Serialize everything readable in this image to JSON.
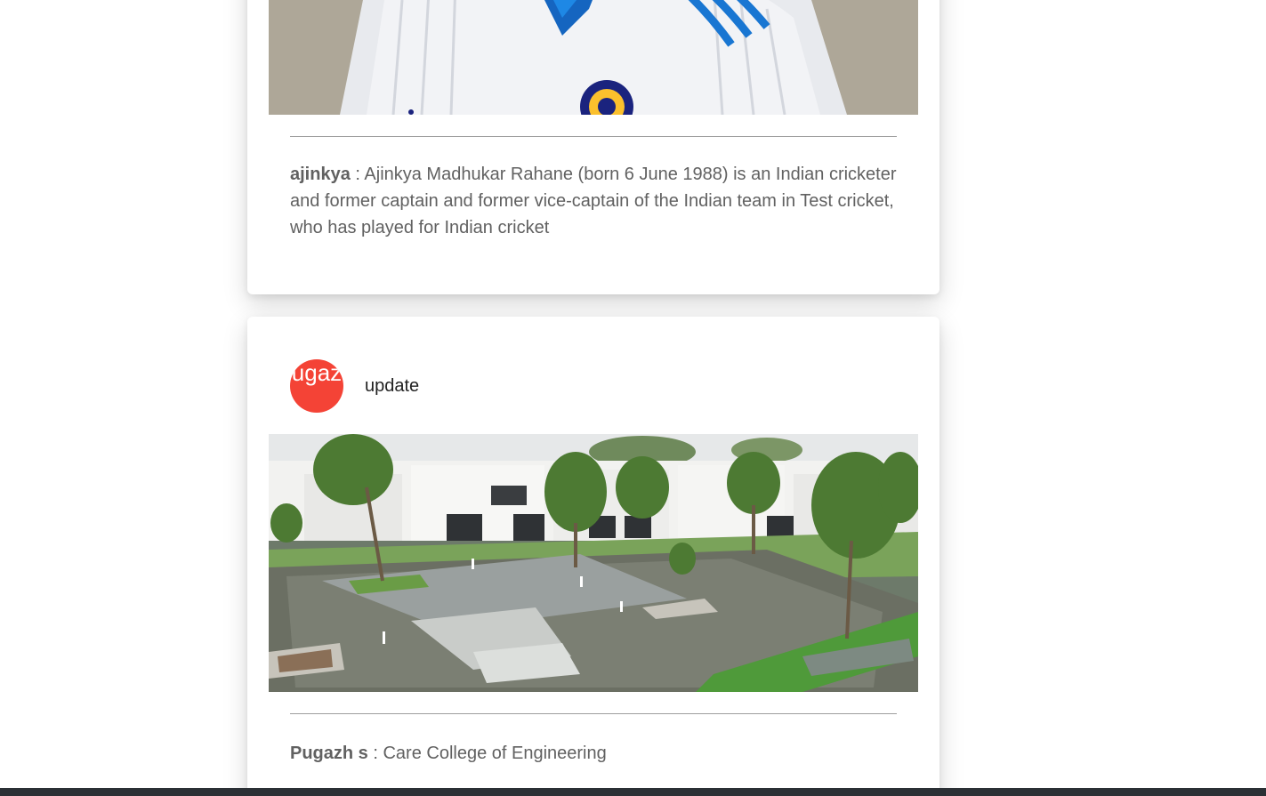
{
  "posts": [
    {
      "image": "cricketer-portrait-photo",
      "author": "ajinkya",
      "separator": " : ",
      "text": "Ajinkya Madhukar Rahane (born 6 June 1988) is an Indian cricketer and former captain and former vice-captain of the Indian team in Test cricket, who has played for Indian cricket"
    },
    {
      "avatar_text": "ugaz",
      "title": "update",
      "image": "college-campus-courtyard-photo",
      "author": "Pugazh s",
      "separator": " : ",
      "text": "Care College of Engineering"
    }
  ],
  "colors": {
    "avatar": "#f44336",
    "divider": "#9e9e9e",
    "caption_text": "#616161",
    "taskbar": "#2b3035"
  }
}
